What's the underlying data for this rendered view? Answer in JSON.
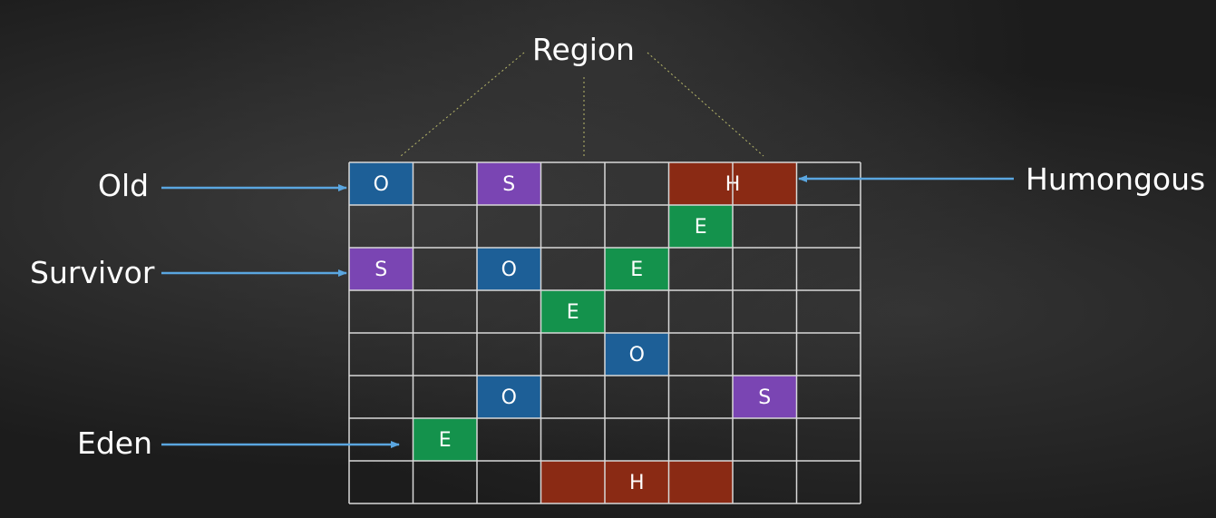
{
  "title": "Region",
  "labels": {
    "old": "Old",
    "survivor": "Survivor",
    "eden": "Eden",
    "humongous": "Humongous"
  },
  "colors": {
    "O": "#1d5f97",
    "S": "#7a45b3",
    "E": "#14924c",
    "H": "#8a2a14",
    "grid": "#d8d8d8",
    "arrow": "#5aa6e0",
    "dotted": "#b8b86a"
  },
  "grid": {
    "columns": 8,
    "rows": 8
  },
  "regions": [
    {
      "row": 0,
      "col": 0,
      "span": 1,
      "type": "O",
      "text": "O"
    },
    {
      "row": 0,
      "col": 2,
      "span": 1,
      "type": "S",
      "text": "S"
    },
    {
      "row": 0,
      "col": 5,
      "span": 2,
      "type": "H",
      "text": "H"
    },
    {
      "row": 1,
      "col": 5,
      "span": 1,
      "type": "E",
      "text": "E"
    },
    {
      "row": 2,
      "col": 0,
      "span": 1,
      "type": "S",
      "text": "S"
    },
    {
      "row": 2,
      "col": 2,
      "span": 1,
      "type": "O",
      "text": "O"
    },
    {
      "row": 2,
      "col": 4,
      "span": 1,
      "type": "E",
      "text": "E"
    },
    {
      "row": 3,
      "col": 3,
      "span": 1,
      "type": "E",
      "text": "E"
    },
    {
      "row": 4,
      "col": 4,
      "span": 1,
      "type": "O",
      "text": "O"
    },
    {
      "row": 5,
      "col": 2,
      "span": 1,
      "type": "O",
      "text": "O"
    },
    {
      "row": 5,
      "col": 6,
      "span": 1,
      "type": "S",
      "text": "S"
    },
    {
      "row": 6,
      "col": 1,
      "span": 1,
      "type": "E",
      "text": "E"
    },
    {
      "row": 7,
      "col": 3,
      "span": 3,
      "type": "H",
      "text": "H"
    }
  ]
}
